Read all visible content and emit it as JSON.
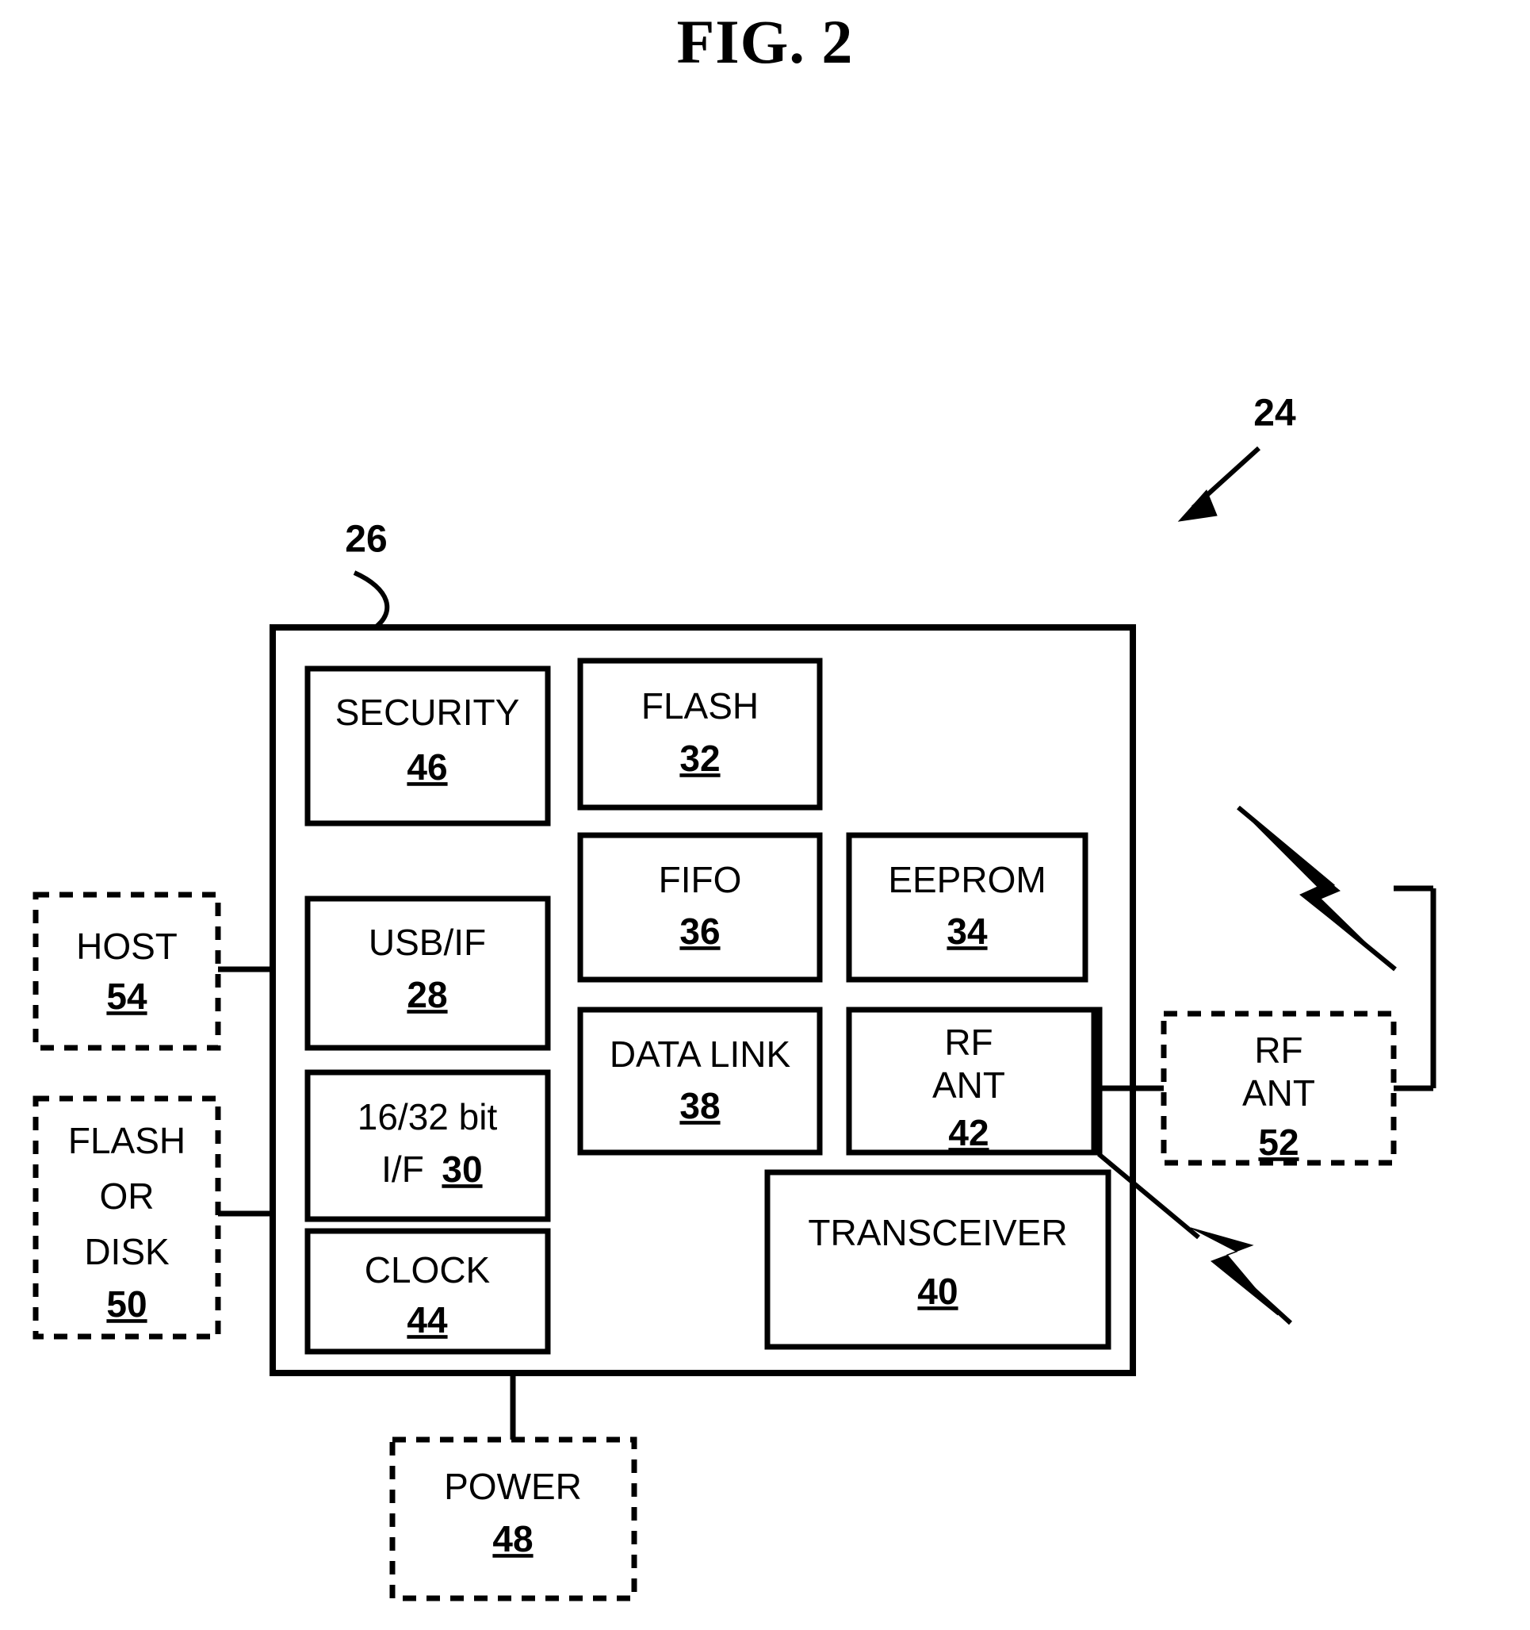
{
  "figure": {
    "title": "FIG. 2",
    "callouts": [
      {
        "id": "device-callout",
        "label": "24"
      },
      {
        "id": "chip-callout",
        "label": "26"
      }
    ]
  },
  "chip": {
    "ref": "26",
    "blocks": [
      {
        "id": "security",
        "label": "SECURITY",
        "ref": "46"
      },
      {
        "id": "flash",
        "label": "FLASH",
        "ref": "32"
      },
      {
        "id": "usb-if",
        "label": "USB/IF",
        "ref": "28"
      },
      {
        "id": "fifo",
        "label": "FIFO",
        "ref": "36"
      },
      {
        "id": "eeprom",
        "label": "EEPROM",
        "ref": "34"
      },
      {
        "id": "bit-if",
        "label_line1": "16/32 bit",
        "label_line2": "I/F",
        "ref": "30"
      },
      {
        "id": "data-link",
        "label": "DATA LINK",
        "ref": "38"
      },
      {
        "id": "rf-ant-internal",
        "label_line1": "RF",
        "label_line2": "ANT",
        "ref": "42"
      },
      {
        "id": "clock",
        "label": "CLOCK",
        "ref": "44"
      },
      {
        "id": "transceiver",
        "label": "TRANSCEIVER",
        "ref": "40"
      }
    ]
  },
  "external": [
    {
      "id": "host",
      "label": "HOST",
      "ref": "54"
    },
    {
      "id": "flash-or-disk",
      "label_line1": "FLASH",
      "label_line2": "OR",
      "label_line3": "DISK",
      "ref": "50"
    },
    {
      "id": "rf-ant-external",
      "label_line1": "RF",
      "label_line2": "ANT",
      "ref": "52"
    },
    {
      "id": "power",
      "label": "POWER",
      "ref": "48"
    }
  ],
  "colors": {
    "ink": "#000000",
    "paper": "#ffffff"
  }
}
